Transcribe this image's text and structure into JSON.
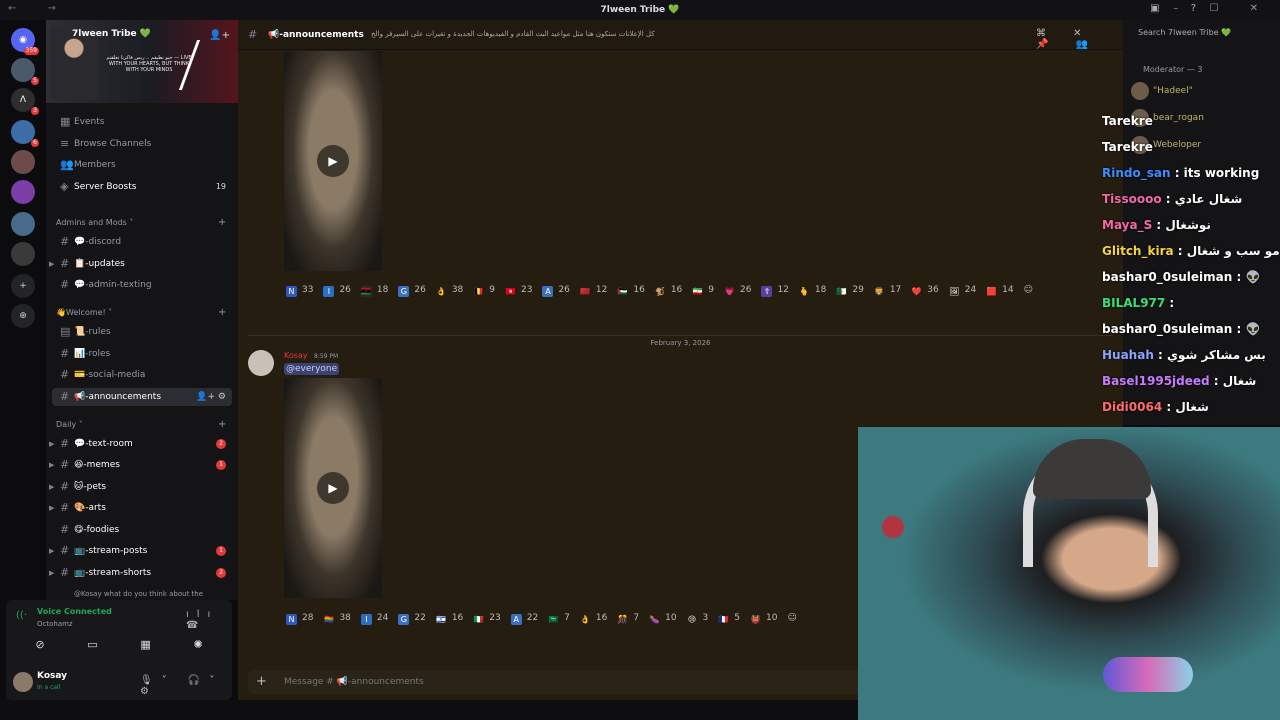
{
  "window": {
    "title": "7lween Tribe 💚"
  },
  "server": {
    "name": "7lween Tribe 💚",
    "banner_tagline": "خيو نطيقم .. ريس فاكرنا تعلقتم — LIVE WITH YOUR HEARTS, BUT THINK WITH YOUR MINDS"
  },
  "guild_badges": {
    "home": "359",
    "g2": "5",
    "g3": "3",
    "g4": "6"
  },
  "nav_items": [
    {
      "label": "Events"
    },
    {
      "label": "Browse Channels"
    },
    {
      "label": "Members"
    },
    {
      "label": "Server Boosts",
      "count": "19"
    }
  ],
  "categories": {
    "mods": "Admins and Mods",
    "welcome": "👋Welcome!",
    "daily": "Daily"
  },
  "mod_channels": [
    {
      "label": "💬-discord"
    },
    {
      "label": "📋-updates"
    },
    {
      "label": "💬-admin-texting"
    }
  ],
  "welcome_channels": [
    {
      "label": "📜-rules"
    },
    {
      "label": "📊-roles"
    },
    {
      "label": "💳-social-media"
    },
    {
      "label": "📢-announcements"
    }
  ],
  "daily_channels": [
    {
      "label": "💬-text-room",
      "badge": "2"
    },
    {
      "label": "😆-memes",
      "badge": "1"
    },
    {
      "label": "🐱-pets",
      "badge": ""
    },
    {
      "label": "🎨-arts",
      "badge": ""
    },
    {
      "label": "😋-foodies",
      "badge": ""
    },
    {
      "label": "📺-stream-posts",
      "badge": "1"
    },
    {
      "label": "📺-stream-shorts",
      "badge": "2"
    }
  ],
  "thread_preview": "@Kosay what do you think about the",
  "voice": {
    "status": "Voice Connected",
    "channel": "Octohamz"
  },
  "user": {
    "name": "Kosay",
    "status": "In a call"
  },
  "channel": {
    "name": "📢-announcements",
    "topic": "كل الإعلانات ستكون هنا مثل مواعيد البث القادم و الفيديوهات الجديدة و تغيرات على السيرفر والخ"
  },
  "search": {
    "placeholder": "Search 7lween Tribe 💚"
  },
  "reactions_1": [
    {
      "e": "N",
      "c": "33",
      "color": "#2b58c4"
    },
    {
      "e": "I",
      "c": "26",
      "color": "#2b6ec4"
    },
    {
      "e": "🇱🇾",
      "c": "18",
      "color": "#2a2a2a"
    },
    {
      "e": "G",
      "c": "26",
      "color": "#3a6fc2"
    },
    {
      "e": "👌",
      "c": "38",
      "color": ""
    },
    {
      "e": "🇧🇪",
      "c": "9",
      "color": ""
    },
    {
      "e": "🇹🇳",
      "c": "23",
      "color": ""
    },
    {
      "e": "A",
      "c": "26",
      "color": "#3a6fc2"
    },
    {
      "e": "🇲🇦",
      "c": "12",
      "color": ""
    },
    {
      "e": "🇵🇸",
      "c": "16",
      "color": ""
    },
    {
      "e": "🐒",
      "c": "16",
      "color": ""
    },
    {
      "e": "🇮🇷",
      "c": "9",
      "color": ""
    },
    {
      "e": "💗",
      "c": "26",
      "color": ""
    },
    {
      "e": "☦",
      "c": "12",
      "color": "#5b3fa0"
    },
    {
      "e": "🫰",
      "c": "18",
      "color": ""
    },
    {
      "e": "🇩🇿",
      "c": "29",
      "color": ""
    },
    {
      "e": "🦁",
      "c": "17",
      "color": ""
    },
    {
      "e": "❤️",
      "c": "36",
      "color": ""
    },
    {
      "e": "🖼",
      "c": "24",
      "color": ""
    },
    {
      "e": "🟥",
      "c": "14",
      "color": ""
    }
  ],
  "date_separator": "February 3, 2026",
  "message": {
    "author": "Kosay",
    "time": "8:59 PM",
    "mention": "@everyone"
  },
  "reactions_2": [
    {
      "e": "N",
      "c": "28",
      "color": "#2b58c4"
    },
    {
      "e": "🏳️‍🌈",
      "c": "38",
      "color": ""
    },
    {
      "e": "I",
      "c": "24",
      "color": "#2b6ec4"
    },
    {
      "e": "G",
      "c": "22",
      "color": "#3a6fc2"
    },
    {
      "e": "🇮🇱",
      "c": "16",
      "color": ""
    },
    {
      "e": "🇮🇹",
      "c": "23",
      "color": ""
    },
    {
      "e": "A",
      "c": "22",
      "color": "#3a6fc2"
    },
    {
      "e": "🇸🇦",
      "c": "7",
      "color": ""
    },
    {
      "e": "👌",
      "c": "16",
      "color": ""
    },
    {
      "e": "🎊",
      "c": "7",
      "color": ""
    },
    {
      "e": "🍆",
      "c": "10",
      "color": ""
    },
    {
      "e": "😢",
      "c": "3",
      "color": ""
    },
    {
      "e": "🇫🇷",
      "c": "5",
      "color": ""
    },
    {
      "e": "👹",
      "c": "10",
      "color": ""
    }
  ],
  "composer": {
    "placeholder": "Message # 📢-announcements"
  },
  "members": {
    "group": "Moderator — 3",
    "list": [
      "\"Hadeel\"",
      "bear_rogan",
      "Webeloper"
    ]
  },
  "chat_overlay": [
    {
      "name": "Tarekre",
      "text": "",
      "color": "#ffffff"
    },
    {
      "name": "Tarekre",
      "text": "",
      "color": "#ffffff"
    },
    {
      "name": "Rindo_san",
      "text": ": its working",
      "color": "#3b8cff"
    },
    {
      "name": "Tissoooo",
      "text": ": شغال عادي",
      "color": "#f06aa6"
    },
    {
      "name": "Maya_S",
      "text": ": نوشغال",
      "color": "#f06aa6"
    },
    {
      "name": "Glitch_kira",
      "text": ": انا مو سب و شغال",
      "color": "#f5d33c"
    },
    {
      "name": "bashar0_0suleiman",
      "text": ": 👽",
      "color": "#ffffff"
    },
    {
      "name": "BILAL977",
      "text": ":",
      "color": "#39e07a"
    },
    {
      "name": "bashar0_0suleiman",
      "text": ": 👽",
      "color": "#ffffff"
    },
    {
      "name": "Huahah",
      "text": ": بس مشاكر شوي",
      "color": "#8aa4ff"
    },
    {
      "name": "Basel1995jdeed",
      "text": ": شغال",
      "color": "#c97bff"
    },
    {
      "name": "Didi0064",
      "text": ": شغال",
      "color": "#ff6a6a"
    }
  ]
}
